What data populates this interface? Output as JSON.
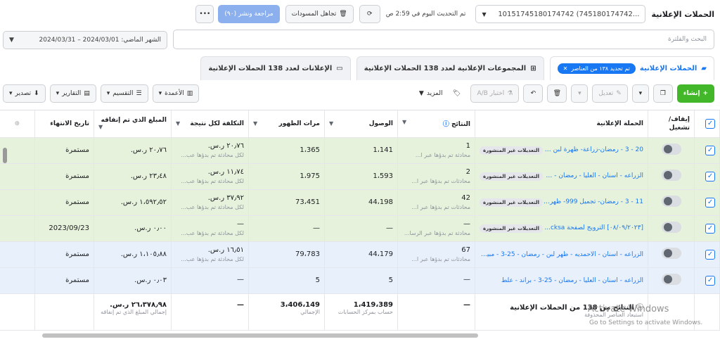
{
  "header": {
    "title": "الحملات الإعلانية",
    "account": "10151745180174742 (745180174742...",
    "updated": "تم التحديث اليوم في 2:59 ص",
    "discard_label": "تجاهل المسودات",
    "review_label": "مراجعة ونشر (٩٠)"
  },
  "search": {
    "placeholder": "البحث والفلترة"
  },
  "date": {
    "label": "الشهر الماضي: 2024/03/01 – 2024/03/31"
  },
  "tabs": [
    {
      "label": "الحملات الإعلانية",
      "chip": "تم تحديد ١٣٨ من العناصر"
    },
    {
      "label": "المجموعات الإعلانية لعدد 138 الحملات الإعلانية"
    },
    {
      "label": "الإعلانات لعدد 138 الحملات الإعلانية"
    }
  ],
  "toolbar": {
    "create": "إنشاء",
    "edit": "تعديل",
    "ab": "اختبار A/B",
    "more": "المزيد",
    "columns": "الأعمدة",
    "breakdown": "التقسيم",
    "reports": "التقارير",
    "export": "تصدير"
  },
  "columns": [
    "إيقاف/تشغيل",
    "الحملة الإعلانية",
    "النتائج",
    "الوصول",
    "مرات الظهور",
    "التكلفة لكل نتيجة",
    "المبلغ الذي تم إنفاقه",
    "تاريخ الانتهاء"
  ],
  "status_badge": "التعديلات غير المنشورة",
  "rows": [
    {
      "name": "20 - 3 - رمضان-زراعة- ظهرة لبن - الا...",
      "results": "1",
      "results_sub": "محادثة تم بدؤها عبر ا...",
      "reach": "1،141",
      "impr": "1،365",
      "cpr": "٢٠٫٧٦ ر.س.",
      "cpr_sub": "لكل محادثة تم بدؤها عب...",
      "spent": "٢٠٫٧٦ ر.س.",
      "end": "مستمرة"
    },
    {
      "name": "الزراعه - اسنان - العليا - رمضان - 11-...",
      "results": "2",
      "results_sub": "محادثات تم بدؤها عبر ا...",
      "reach": "1،593",
      "impr": "1،975",
      "cpr": "١١٫٧٤ ر.س.",
      "cpr_sub": "لكل محادثة تم بدؤها عب...",
      "spent": "٢٣٫٤٨ ر.س.",
      "end": "مستمرة"
    },
    {
      "name": "11 - 3 - رمضان- تجميل 999- ظهرة ل...",
      "results": "42",
      "results_sub": "محادثات تم بدؤها عبر ا...",
      "reach": "44،198",
      "impr": "73،451",
      "cpr": "٣٧٫٩٢ ر.س.",
      "cpr_sub": "لكل محادثة تم بدؤها عب...",
      "spent": "١،٥٩٢٫٥٢ ر.س.",
      "end": "مستمرة"
    },
    {
      "name": "[٠٨/٠٩/٢٠٢٣] الترويج لصفحة cksa...",
      "results": "—",
      "results_sub": "محادثة تم بدؤها عبر الرسا...",
      "reach": "—",
      "impr": "—",
      "cpr": "—",
      "cpr_sub": "لكل محادثة تم بدؤها عب...",
      "spent": "٠٫٠٠ ر.س.",
      "end": "2023/09/23"
    },
    {
      "name": "الزراعه - اسنان - الاحمديه - ظهر لبن - رمضان - 25-3 - مبيعات",
      "results": "67",
      "results_sub": "محادثات تم بدؤها عبر ا...",
      "reach": "44،179",
      "impr": "79،783",
      "cpr": "١٦٫٥١ ر.س.",
      "cpr_sub": "لكل محادثة تم بدؤها عب...",
      "spent": "١،١٠٥٫٨٨ ر.س.",
      "end": "مستمرة"
    },
    {
      "name": "الزراعه - اسنان - العليا - رمضان - 25-3 - براند - علط",
      "results": "—",
      "results_sub": "",
      "reach": "5",
      "impr": "5",
      "cpr": "—",
      "cpr_sub": "",
      "spent": "٠٫٠٣ ر.س.",
      "end": "مستمرة"
    }
  ],
  "totals": {
    "label": "النتائج من 138 من الحملات الإعلانية",
    "label_sub": "استبعاد العناصر المحذوفة",
    "results": "—",
    "reach": "1،419،389",
    "reach_sub": "حساب بمركز الحسابات",
    "impr": "3،406،149",
    "impr_sub": "الإجمالي",
    "cpr": "—",
    "spent": "٢٦،٣٧٨٫٩٨ ر.س.",
    "spent_sub": "إجمالي المبلغ الذي تم إنفاقه"
  },
  "watermark": {
    "title": "Activate Windows",
    "sub": "Go to Settings to activate Windows."
  }
}
